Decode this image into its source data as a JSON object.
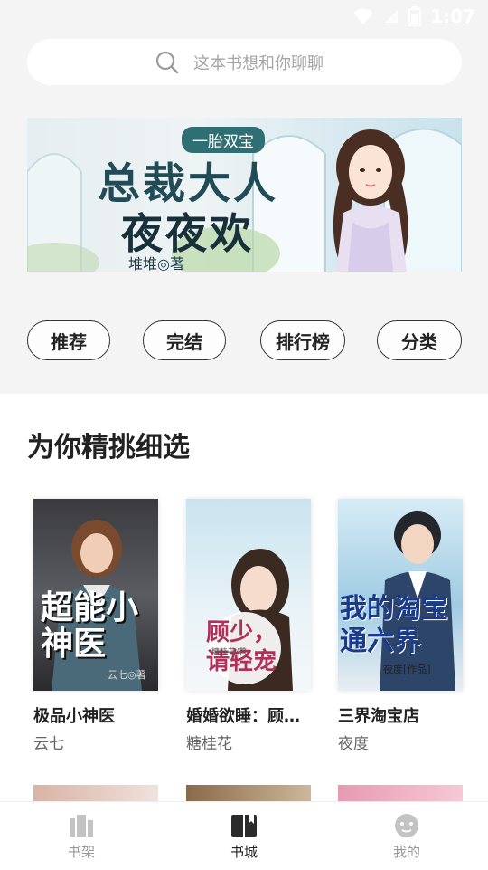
{
  "status_bar": {
    "time": "1:07"
  },
  "search": {
    "placeholder": "这本书想和你聊聊"
  },
  "banner": {
    "tag": "一胎双宝",
    "title_line1": "总裁大人",
    "title_line2": "夜夜欢",
    "author": "堆堆◎著"
  },
  "categories": [
    {
      "label": "推荐"
    },
    {
      "label": "完结"
    },
    {
      "label": "排行榜"
    },
    {
      "label": "分类"
    }
  ],
  "section": {
    "title": "为你精挑细选"
  },
  "books": [
    {
      "name": "极品小神医",
      "author": "云七",
      "cover_title": "超能小神医",
      "cover_author": "云七◎著"
    },
    {
      "name": "婚婚欲睡：顾少...",
      "author": "糖桂花",
      "cover_title": "顾少，请轻宠",
      "cover_author": "糖桂花/著"
    },
    {
      "name": "三界淘宝店",
      "author": "夜度",
      "cover_title": "我的淘宝通六界",
      "cover_author": "夜度[作品]"
    }
  ],
  "tabs": [
    {
      "label": "书架",
      "icon": "bookshelf-icon"
    },
    {
      "label": "书城",
      "icon": "book-open-icon"
    },
    {
      "label": "我的",
      "icon": "profile-face-icon"
    }
  ],
  "colors": {
    "accent": "#222222",
    "muted": "#999999",
    "page_bg": "#f4f4f4"
  }
}
